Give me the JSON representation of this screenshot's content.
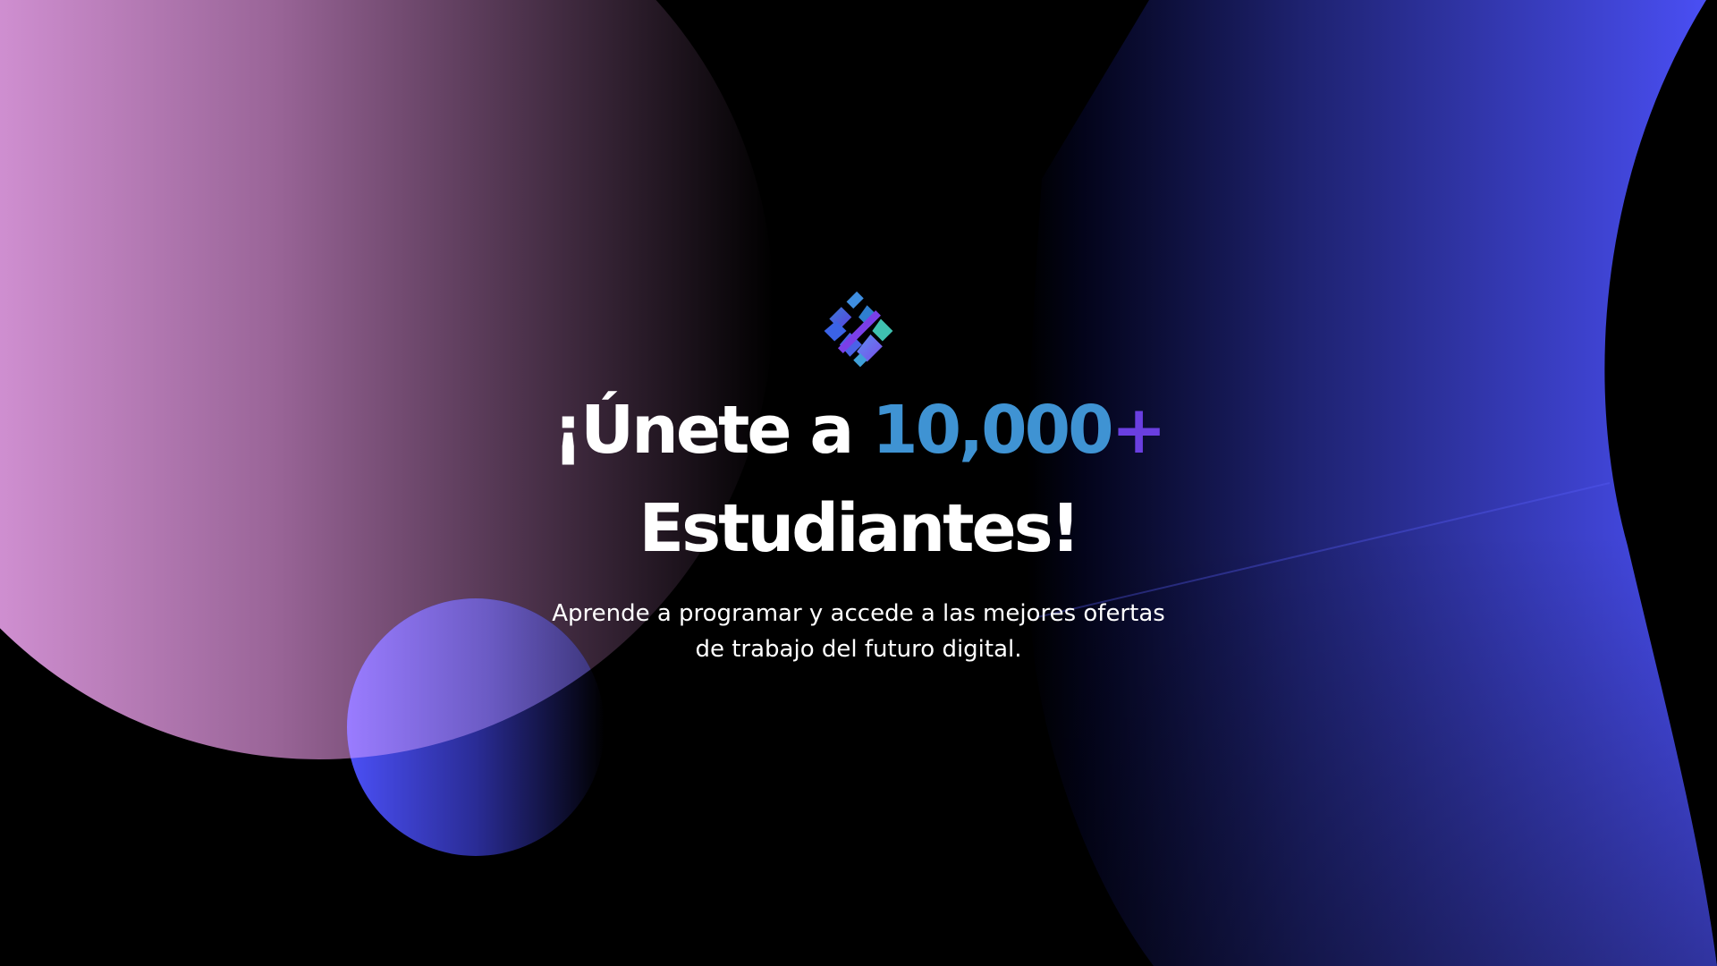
{
  "hero": {
    "headline_prefix": "¡Únete a ",
    "headline_number": "10,000",
    "headline_plus": "+",
    "headline_line2": "Estudiantes!",
    "subtitle_line1": "Aprende a programar y accede a las mejores ofertas",
    "subtitle_line2": "de trabajo del futuro digital."
  },
  "colors": {
    "background": "#000000",
    "text": "#ffffff",
    "accent_number": "#3f93d3",
    "accent_plus": "#6a3fe0",
    "pink": "#e9a3ec",
    "violet": "#9a7cff",
    "blue": "#4b50f7",
    "teal": "#3fc1b0"
  },
  "icons": {
    "logo": "diamond-logo-icon"
  }
}
